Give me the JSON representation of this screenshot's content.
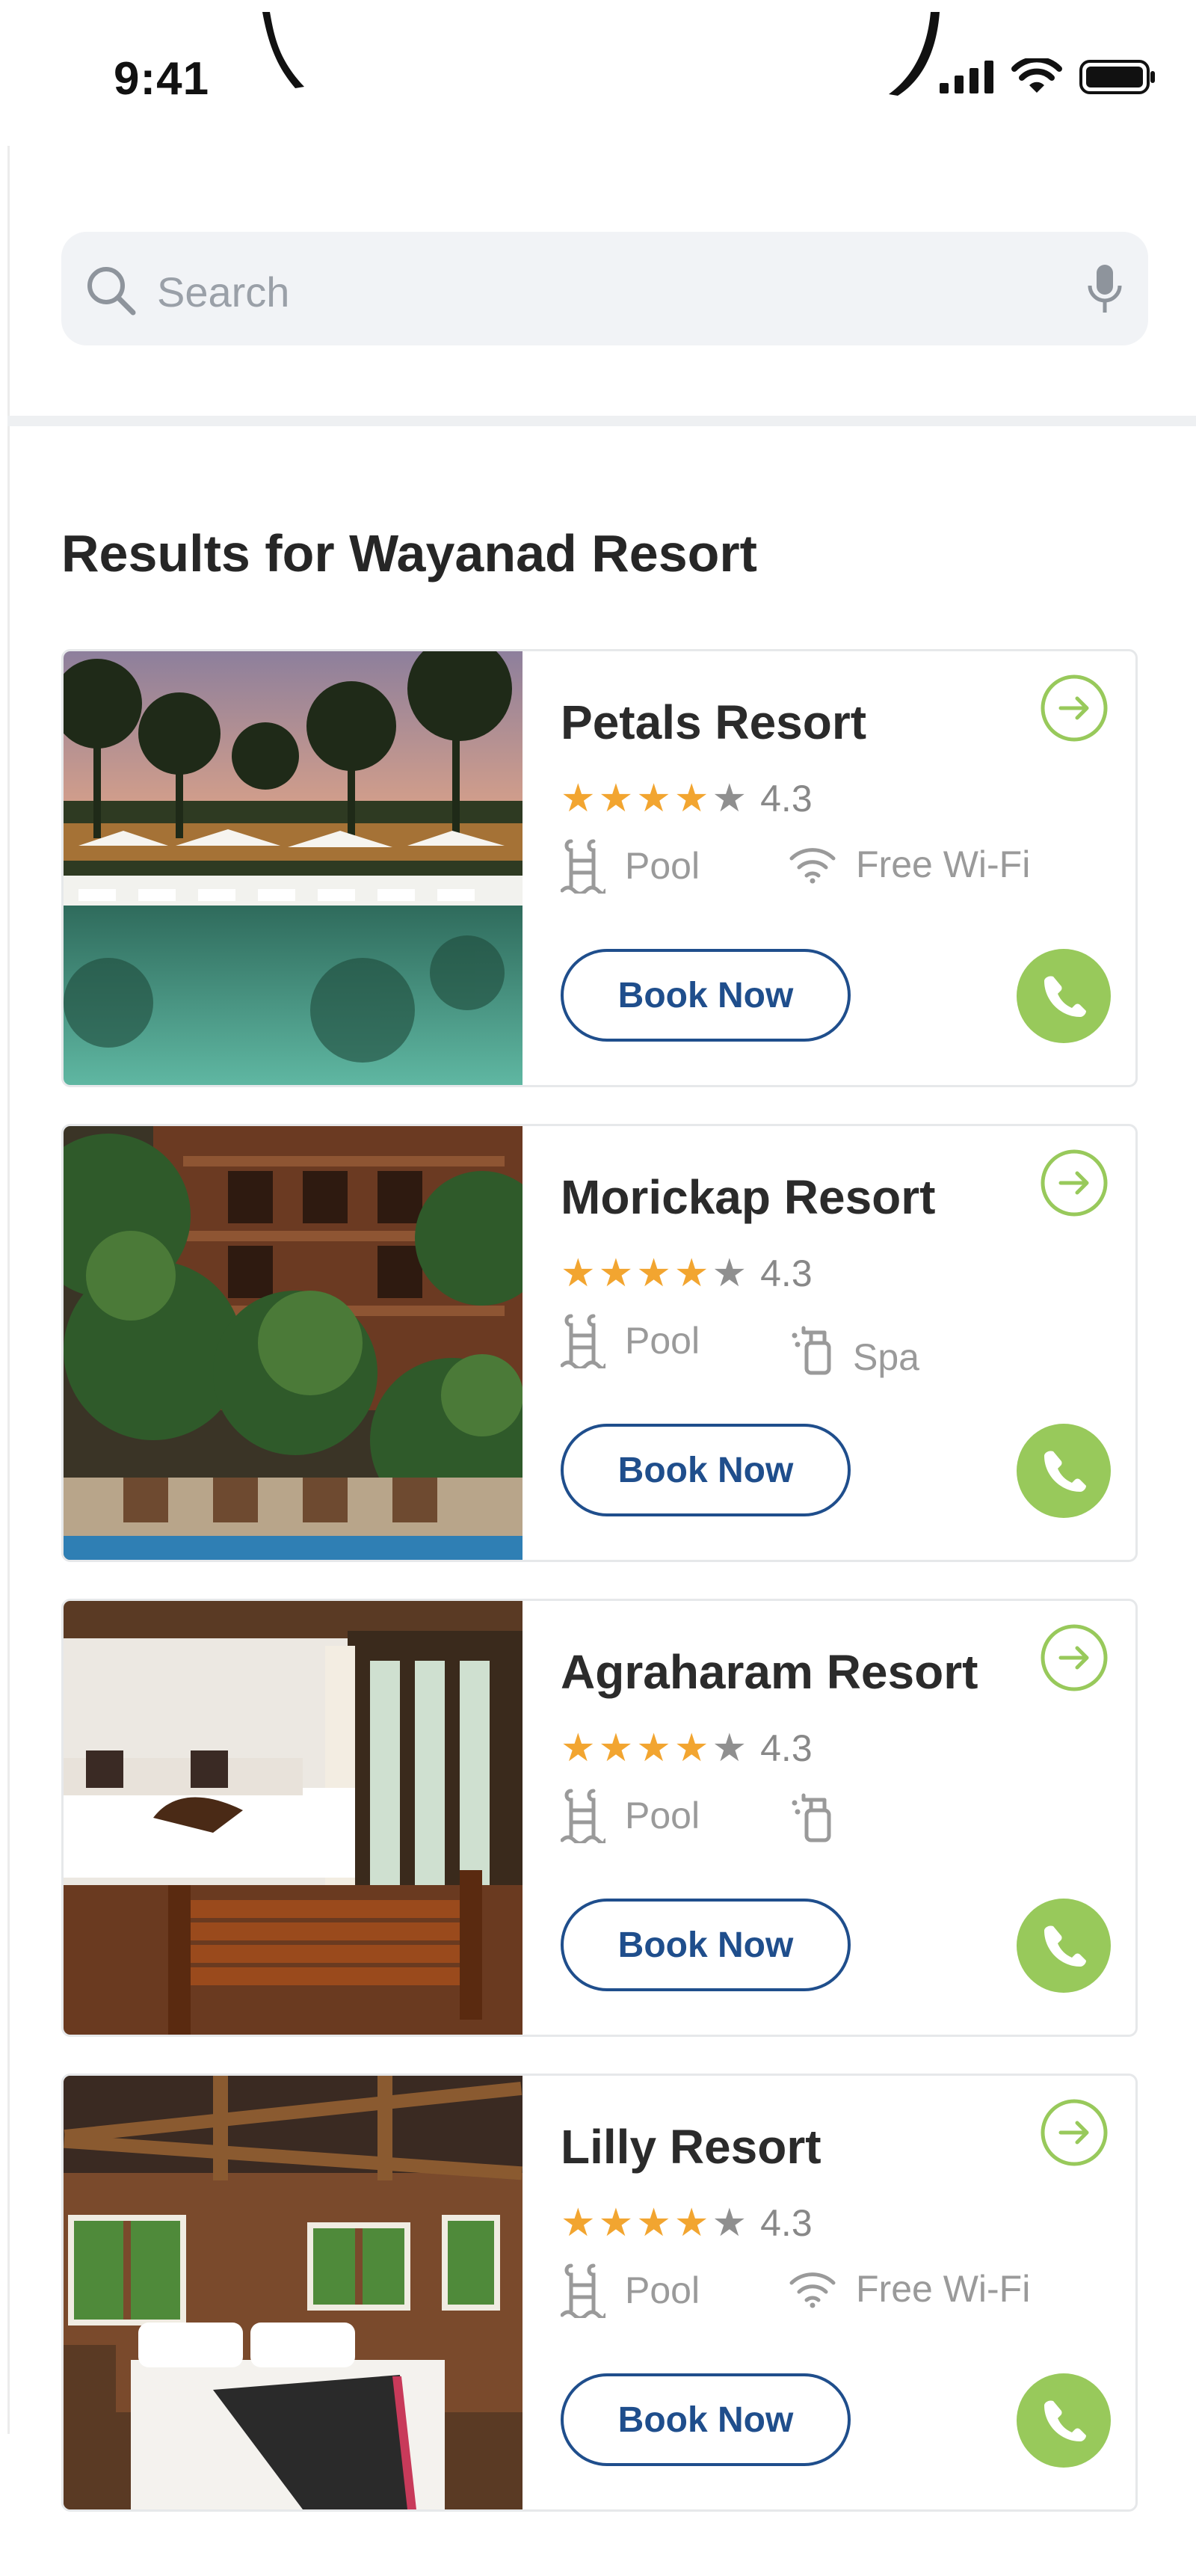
{
  "status_bar": {
    "time": "9:41",
    "icons": [
      "signal-icon",
      "wifi-icon",
      "battery-icon"
    ]
  },
  "search": {
    "placeholder": "Search",
    "icons": [
      "search-icon",
      "mic-icon"
    ]
  },
  "results": {
    "title": "Results for Wayanad Resort",
    "book_label": "Book Now",
    "cards": [
      {
        "name": "Petals Resort",
        "rating_value": "4.3",
        "stars_filled": 4,
        "stars_total": 5,
        "amenities": [
          {
            "icon": "pool-ladder-icon",
            "label": "Pool"
          },
          {
            "icon": "wifi-icon",
            "label": "Free Wi-Fi"
          }
        ]
      },
      {
        "name": "Morickap Resort",
        "rating_value": "4.3",
        "stars_filled": 4,
        "stars_total": 5,
        "amenities": [
          {
            "icon": "pool-ladder-icon",
            "label": "Pool"
          },
          {
            "icon": "spa-icon",
            "label": "Spa"
          }
        ]
      },
      {
        "name": "Agraharam Resort",
        "rating_value": "4.3",
        "stars_filled": 4,
        "stars_total": 5,
        "amenities": [
          {
            "icon": "pool-ladder-icon",
            "label": "Pool"
          },
          {
            "icon": "spa-icon",
            "label": ""
          }
        ]
      },
      {
        "name": "Lilly Resort",
        "rating_value": "4.3",
        "stars_filled": 4,
        "stars_total": 5,
        "amenities": [
          {
            "icon": "pool-ladder-icon",
            "label": "Pool"
          },
          {
            "icon": "wifi-icon",
            "label": "Free Wi-Fi"
          }
        ]
      }
    ]
  },
  "colors": {
    "accent_green": "#98c95b",
    "button_blue": "#1f4e8c",
    "star_gold": "#f2a530",
    "star_grey": "#8f8f8f"
  }
}
